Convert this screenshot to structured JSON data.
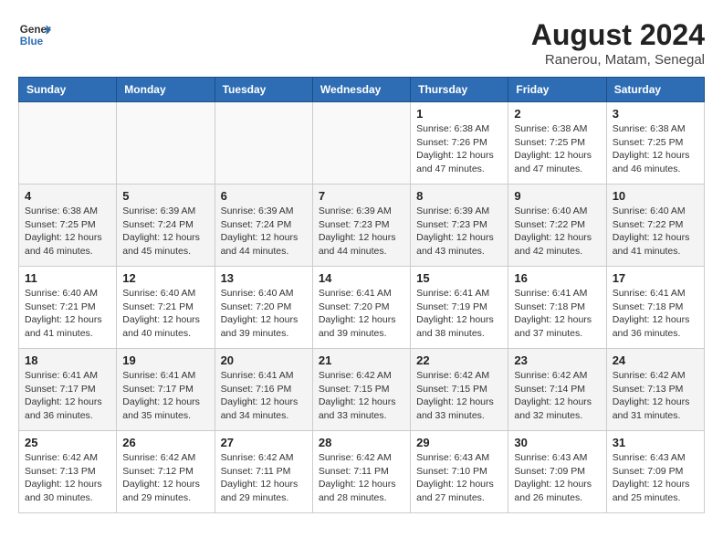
{
  "header": {
    "logo_general": "General",
    "logo_blue": "Blue",
    "title": "August 2024",
    "subtitle": "Ranerou, Matam, Senegal"
  },
  "days_of_week": [
    "Sunday",
    "Monday",
    "Tuesday",
    "Wednesday",
    "Thursday",
    "Friday",
    "Saturday"
  ],
  "weeks": [
    [
      {
        "day": "",
        "info": ""
      },
      {
        "day": "",
        "info": ""
      },
      {
        "day": "",
        "info": ""
      },
      {
        "day": "",
        "info": ""
      },
      {
        "day": "1",
        "info": "Sunrise: 6:38 AM\nSunset: 7:26 PM\nDaylight: 12 hours\nand 47 minutes."
      },
      {
        "day": "2",
        "info": "Sunrise: 6:38 AM\nSunset: 7:25 PM\nDaylight: 12 hours\nand 47 minutes."
      },
      {
        "day": "3",
        "info": "Sunrise: 6:38 AM\nSunset: 7:25 PM\nDaylight: 12 hours\nand 46 minutes."
      }
    ],
    [
      {
        "day": "4",
        "info": "Sunrise: 6:38 AM\nSunset: 7:25 PM\nDaylight: 12 hours\nand 46 minutes."
      },
      {
        "day": "5",
        "info": "Sunrise: 6:39 AM\nSunset: 7:24 PM\nDaylight: 12 hours\nand 45 minutes."
      },
      {
        "day": "6",
        "info": "Sunrise: 6:39 AM\nSunset: 7:24 PM\nDaylight: 12 hours\nand 44 minutes."
      },
      {
        "day": "7",
        "info": "Sunrise: 6:39 AM\nSunset: 7:23 PM\nDaylight: 12 hours\nand 44 minutes."
      },
      {
        "day": "8",
        "info": "Sunrise: 6:39 AM\nSunset: 7:23 PM\nDaylight: 12 hours\nand 43 minutes."
      },
      {
        "day": "9",
        "info": "Sunrise: 6:40 AM\nSunset: 7:22 PM\nDaylight: 12 hours\nand 42 minutes."
      },
      {
        "day": "10",
        "info": "Sunrise: 6:40 AM\nSunset: 7:22 PM\nDaylight: 12 hours\nand 41 minutes."
      }
    ],
    [
      {
        "day": "11",
        "info": "Sunrise: 6:40 AM\nSunset: 7:21 PM\nDaylight: 12 hours\nand 41 minutes."
      },
      {
        "day": "12",
        "info": "Sunrise: 6:40 AM\nSunset: 7:21 PM\nDaylight: 12 hours\nand 40 minutes."
      },
      {
        "day": "13",
        "info": "Sunrise: 6:40 AM\nSunset: 7:20 PM\nDaylight: 12 hours\nand 39 minutes."
      },
      {
        "day": "14",
        "info": "Sunrise: 6:41 AM\nSunset: 7:20 PM\nDaylight: 12 hours\nand 39 minutes."
      },
      {
        "day": "15",
        "info": "Sunrise: 6:41 AM\nSunset: 7:19 PM\nDaylight: 12 hours\nand 38 minutes."
      },
      {
        "day": "16",
        "info": "Sunrise: 6:41 AM\nSunset: 7:18 PM\nDaylight: 12 hours\nand 37 minutes."
      },
      {
        "day": "17",
        "info": "Sunrise: 6:41 AM\nSunset: 7:18 PM\nDaylight: 12 hours\nand 36 minutes."
      }
    ],
    [
      {
        "day": "18",
        "info": "Sunrise: 6:41 AM\nSunset: 7:17 PM\nDaylight: 12 hours\nand 36 minutes."
      },
      {
        "day": "19",
        "info": "Sunrise: 6:41 AM\nSunset: 7:17 PM\nDaylight: 12 hours\nand 35 minutes."
      },
      {
        "day": "20",
        "info": "Sunrise: 6:41 AM\nSunset: 7:16 PM\nDaylight: 12 hours\nand 34 minutes."
      },
      {
        "day": "21",
        "info": "Sunrise: 6:42 AM\nSunset: 7:15 PM\nDaylight: 12 hours\nand 33 minutes."
      },
      {
        "day": "22",
        "info": "Sunrise: 6:42 AM\nSunset: 7:15 PM\nDaylight: 12 hours\nand 33 minutes."
      },
      {
        "day": "23",
        "info": "Sunrise: 6:42 AM\nSunset: 7:14 PM\nDaylight: 12 hours\nand 32 minutes."
      },
      {
        "day": "24",
        "info": "Sunrise: 6:42 AM\nSunset: 7:13 PM\nDaylight: 12 hours\nand 31 minutes."
      }
    ],
    [
      {
        "day": "25",
        "info": "Sunrise: 6:42 AM\nSunset: 7:13 PM\nDaylight: 12 hours\nand 30 minutes."
      },
      {
        "day": "26",
        "info": "Sunrise: 6:42 AM\nSunset: 7:12 PM\nDaylight: 12 hours\nand 29 minutes."
      },
      {
        "day": "27",
        "info": "Sunrise: 6:42 AM\nSunset: 7:11 PM\nDaylight: 12 hours\nand 29 minutes."
      },
      {
        "day": "28",
        "info": "Sunrise: 6:42 AM\nSunset: 7:11 PM\nDaylight: 12 hours\nand 28 minutes."
      },
      {
        "day": "29",
        "info": "Sunrise: 6:43 AM\nSunset: 7:10 PM\nDaylight: 12 hours\nand 27 minutes."
      },
      {
        "day": "30",
        "info": "Sunrise: 6:43 AM\nSunset: 7:09 PM\nDaylight: 12 hours\nand 26 minutes."
      },
      {
        "day": "31",
        "info": "Sunrise: 6:43 AM\nSunset: 7:09 PM\nDaylight: 12 hours\nand 25 minutes."
      }
    ]
  ]
}
